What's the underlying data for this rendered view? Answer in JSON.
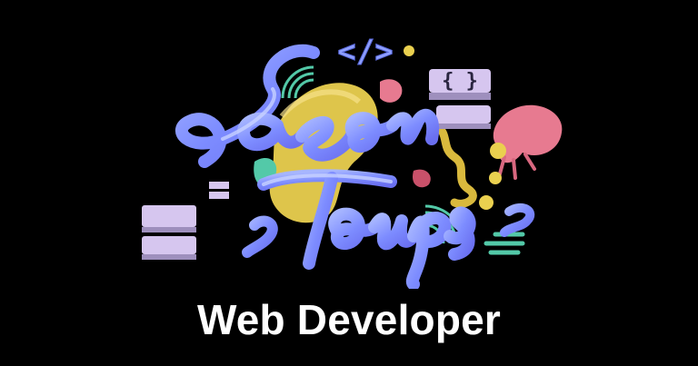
{
  "logo": {
    "signature_text": "Jason Toups",
    "code_glyph_text": "</>",
    "colors": {
      "neon_blue": "#7d8cff",
      "neon_highlight": "#b8c4ff",
      "yellow": "#ead04f",
      "pink": "#e77a90",
      "teal": "#53c9a8",
      "lavender": "#d6c6ef"
    }
  },
  "headline": {
    "text": "Web Developer",
    "color": "#ffffff"
  },
  "background_color": "#000000"
}
